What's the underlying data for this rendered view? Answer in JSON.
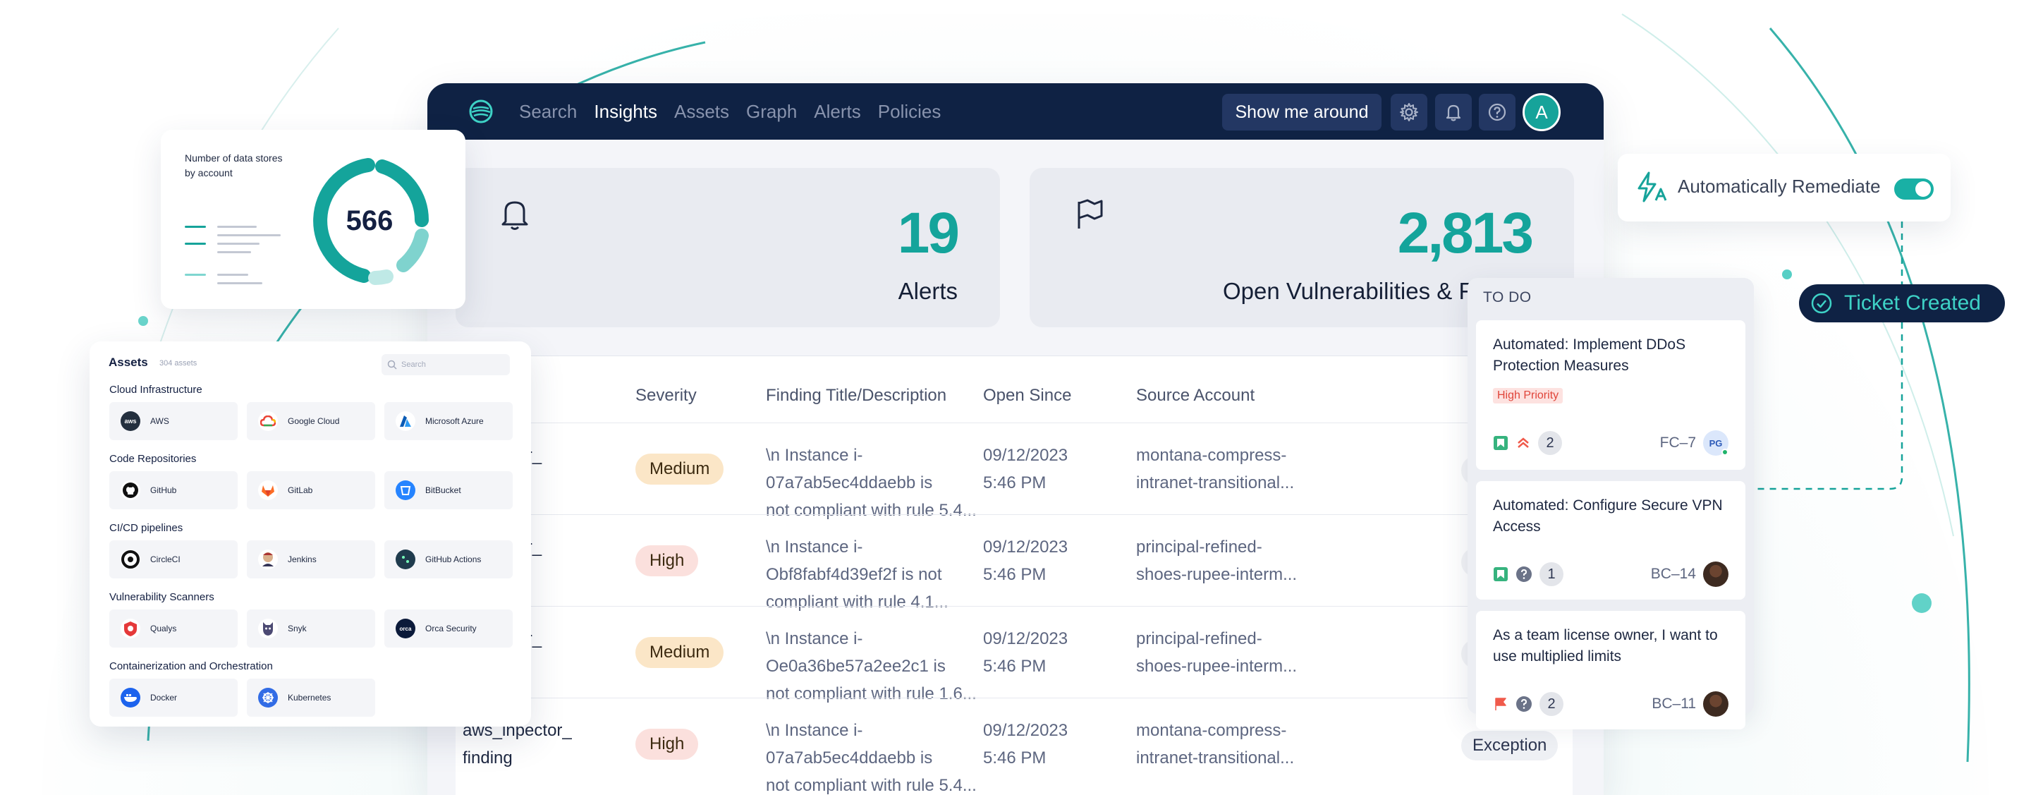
{
  "nav": {
    "items": [
      "Search",
      "Insights",
      "Assets",
      "Graph",
      "Alerts",
      "Policies"
    ],
    "active": "Insights",
    "tour_button": "Show me around",
    "avatar_initial": "A"
  },
  "stats": [
    {
      "icon": "bell-icon",
      "value": "19",
      "label": "Alerts"
    },
    {
      "icon": "flag-icon",
      "value": "2,813",
      "label": "Open Vulnerabilities & Fi"
    }
  ],
  "table": {
    "columns": [
      "Severity",
      "Finding Title/Description",
      "Open Since",
      "Source Account"
    ],
    "rows": [
      {
        "name": [
          "_inpector_",
          ""
        ],
        "severity": "Medium",
        "title": [
          "\\n Instance i-07a7ab5ec4ddaebb is",
          "not compliant with rule 5.4..."
        ],
        "date": [
          "09/12/2023",
          "5:46 PM"
        ],
        "account": [
          "montana-compress-",
          "intranet-transitional..."
        ],
        "status": ""
      },
      {
        "name": [
          "_inpector_",
          ""
        ],
        "severity": "High",
        "title": [
          "\\n Instance i-Obf8fabf4d39ef2f is not",
          "compliant with rule 4.1..."
        ],
        "date": [
          "09/12/2023",
          "5:46 PM"
        ],
        "account": [
          "principal-refined-",
          "shoes-rupee-interm..."
        ],
        "status": ""
      },
      {
        "name": [
          "_inpector_",
          ""
        ],
        "severity": "Medium",
        "title": [
          "\\n Instance i-Oe0a36be57a2ee2c1 is",
          "not compliant with rule 1.6..."
        ],
        "date": [
          "09/12/2023",
          "5:46 PM"
        ],
        "account": [
          "principal-refined-",
          "shoes-rupee-interm..."
        ],
        "status": ""
      },
      {
        "name": [
          "aws_inpector_",
          "finding"
        ],
        "severity": "High",
        "title": [
          "\\n Instance i-07a7ab5ec4ddaebb is",
          "not compliant with rule 5.4..."
        ],
        "date": [
          "09/12/2023",
          "5:46 PM"
        ],
        "account": [
          "montana-compress-",
          "intranet-transitional..."
        ],
        "status": "Exception"
      }
    ]
  },
  "data_stores": {
    "title": "Number of data stores by account",
    "value": "566"
  },
  "assets": {
    "title": "Assets",
    "count": "304 assets",
    "search_placeholder": "Search",
    "sections": [
      {
        "title": "Cloud Infrastructure",
        "items": [
          "AWS",
          "Google Cloud",
          "Microsoft Azure"
        ]
      },
      {
        "title": "Code Repositories",
        "items": [
          "GitHub",
          "GitLab",
          "BitBucket"
        ]
      },
      {
        "title": "CI/CD pipelines",
        "items": [
          "CircleCI",
          "Jenkins",
          "GitHub Actions"
        ]
      },
      {
        "title": "Vulnerability Scanners",
        "items": [
          "Qualys",
          "Snyk",
          "Orca Security"
        ]
      },
      {
        "title": "Containerization and Orchestration",
        "items": [
          "Docker",
          "Kubernetes"
        ]
      }
    ]
  },
  "todo": {
    "title": "TO DO",
    "tasks": [
      {
        "text": "Automated: Implement DDoS Protection Measures",
        "priority": "High Priority",
        "count": "2",
        "id": "FC–7",
        "avatar": "PG"
      },
      {
        "text": "Automated: Configure Secure VPN Access",
        "priority": "",
        "count": "1",
        "id": "BC–14",
        "avatar": ""
      },
      {
        "text": "As a team license owner, I want to use multiplied limits",
        "priority": "",
        "count": "2",
        "id": "BC–11",
        "avatar": ""
      }
    ]
  },
  "remediate": {
    "label": "Automatically Remediate",
    "enabled": true
  },
  "ticket": {
    "label": "Ticket Created"
  },
  "colors": {
    "navy": "#0f2244",
    "teal": "#14a49b",
    "accent": "#3ed2c6"
  }
}
